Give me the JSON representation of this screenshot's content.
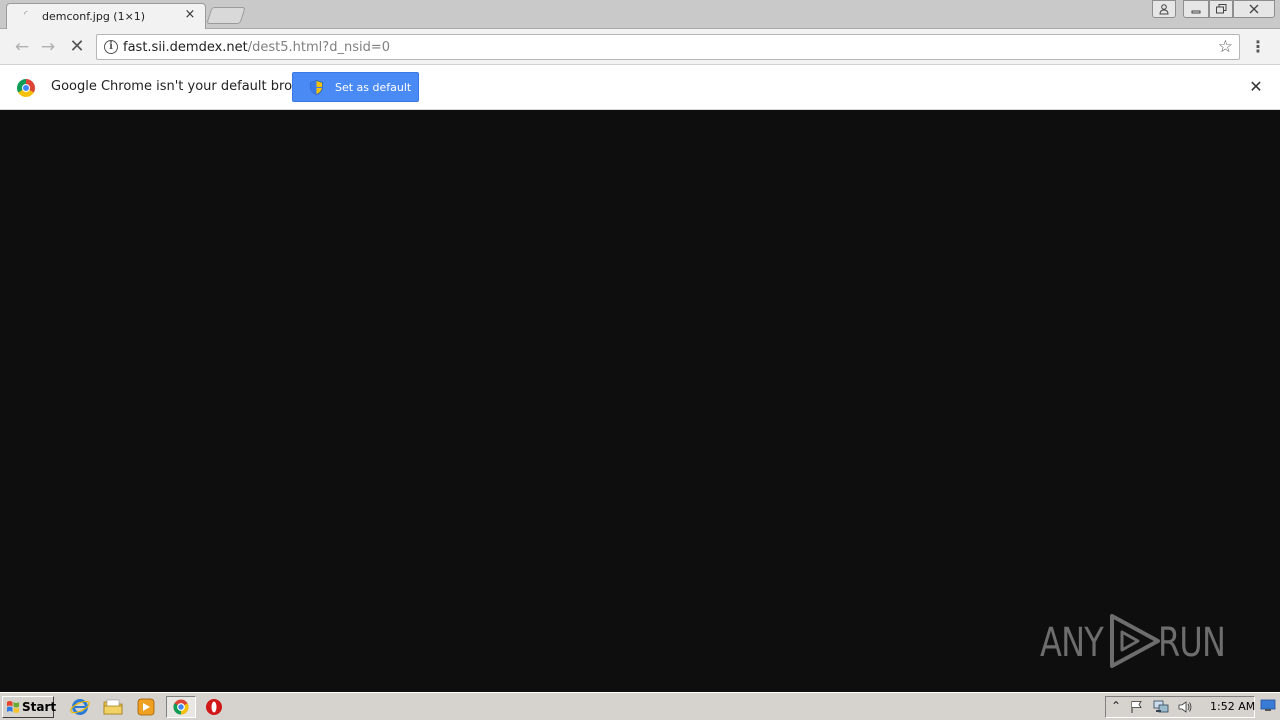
{
  "browser": {
    "tab": {
      "title": "demconf.jpg (1×1)",
      "favicon": "loading-favicon",
      "close_glyph": "×"
    },
    "address": {
      "host": "fast.sii.demdex.net",
      "path": "/dest5.html?d_nsid=0",
      "info_glyph": "i"
    },
    "nav": {
      "back_glyph": "←",
      "forward_glyph": "→",
      "stop_glyph": "✕",
      "star_glyph": "☆",
      "menu_glyph": "⋮"
    },
    "window": {
      "user_glyph": "👤",
      "min_glyph": "—",
      "max_glyph": "❐",
      "close_glyph": "✕"
    }
  },
  "infobar": {
    "message": "Google Chrome isn't your default browser",
    "button_label": "Set as default",
    "close_glyph": "✕"
  },
  "watermark": {
    "left": "ANY",
    "right": "RUN"
  },
  "taskbar": {
    "start_label": "Start",
    "apps": [
      "internet-explorer",
      "windows-explorer",
      "media-player",
      "google-chrome",
      "opera"
    ],
    "clock": "1:52 AM",
    "tray_chevron": "⌃"
  },
  "colors": {
    "content_bg": "#0e0e0e",
    "button_blue": "#4a8af4",
    "taskbar": "#d6d3ce"
  }
}
